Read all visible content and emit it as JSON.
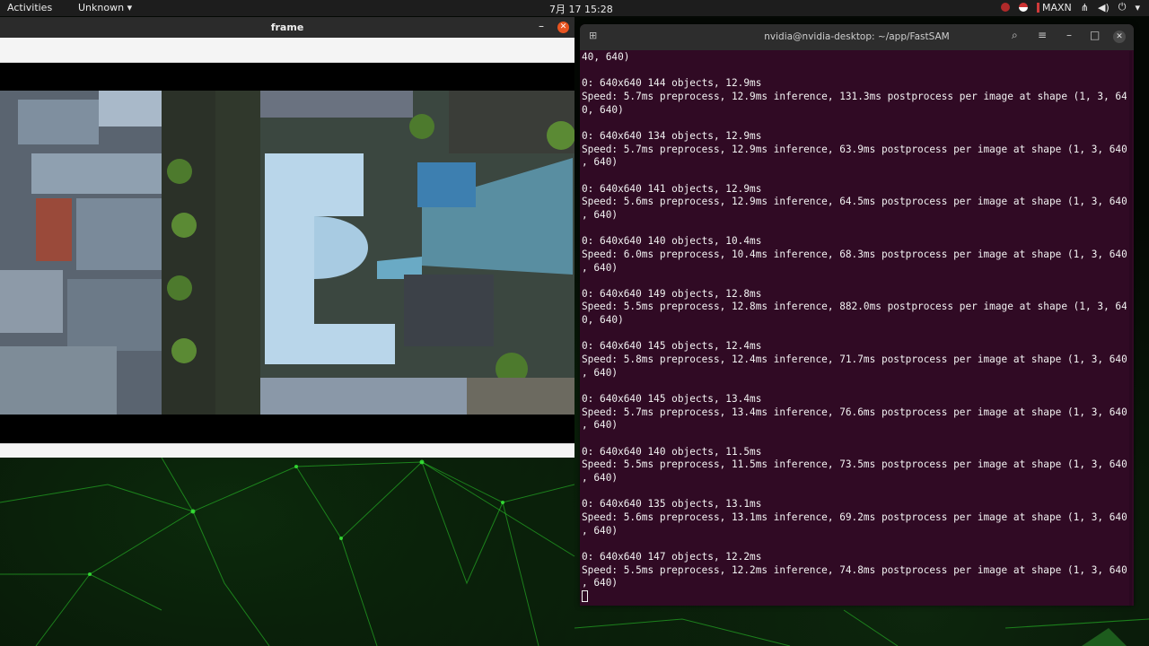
{
  "topbar": {
    "activities": "Activities",
    "app_menu": "Unknown",
    "clock": "7月 17  15:28",
    "power_mode": "MAXN"
  },
  "frame_window": {
    "title": "frame"
  },
  "terminal": {
    "title": "nvidia@nvidia-desktop: ~/app/FastSAM",
    "lines": [
      "40, 640)",
      "",
      "0: 640x640 144 objects, 12.9ms",
      "Speed: 5.7ms preprocess, 12.9ms inference, 131.3ms postprocess per image at shape (1, 3, 64",
      "0, 640)",
      "",
      "0: 640x640 134 objects, 12.9ms",
      "Speed: 5.7ms preprocess, 12.9ms inference, 63.9ms postprocess per image at shape (1, 3, 640",
      ", 640)",
      "",
      "0: 640x640 141 objects, 12.9ms",
      "Speed: 5.6ms preprocess, 12.9ms inference, 64.5ms postprocess per image at shape (1, 3, 640",
      ", 640)",
      "",
      "0: 640x640 140 objects, 10.4ms",
      "Speed: 6.0ms preprocess, 10.4ms inference, 68.3ms postprocess per image at shape (1, 3, 640",
      ", 640)",
      "",
      "0: 640x640 149 objects, 12.8ms",
      "Speed: 5.5ms preprocess, 12.8ms inference, 882.0ms postprocess per image at shape (1, 3, 64",
      "0, 640)",
      "",
      "0: 640x640 145 objects, 12.4ms",
      "Speed: 5.8ms preprocess, 12.4ms inference, 71.7ms postprocess per image at shape (1, 3, 640",
      ", 640)",
      "",
      "0: 640x640 145 objects, 13.4ms",
      "Speed: 5.7ms preprocess, 13.4ms inference, 76.6ms postprocess per image at shape (1, 3, 640",
      ", 640)",
      "",
      "0: 640x640 140 objects, 11.5ms",
      "Speed: 5.5ms preprocess, 11.5ms inference, 73.5ms postprocess per image at shape (1, 3, 640",
      ", 640)",
      "",
      "0: 640x640 135 objects, 13.1ms",
      "Speed: 5.6ms preprocess, 13.1ms inference, 69.2ms postprocess per image at shape (1, 3, 640",
      ", 640)",
      "",
      "0: 640x640 147 objects, 12.2ms",
      "Speed: 5.5ms preprocess, 12.2ms inference, 74.8ms postprocess per image at shape (1, 3, 640",
      ", 640)"
    ]
  },
  "icons": {
    "dropdown": "chevron-down-icon",
    "record": "record-icon",
    "network": "network-icon",
    "volume": "volume-icon",
    "power": "power-icon"
  },
  "colors": {
    "terminal_bg": "#300a24",
    "accent_close": "#e95420"
  }
}
